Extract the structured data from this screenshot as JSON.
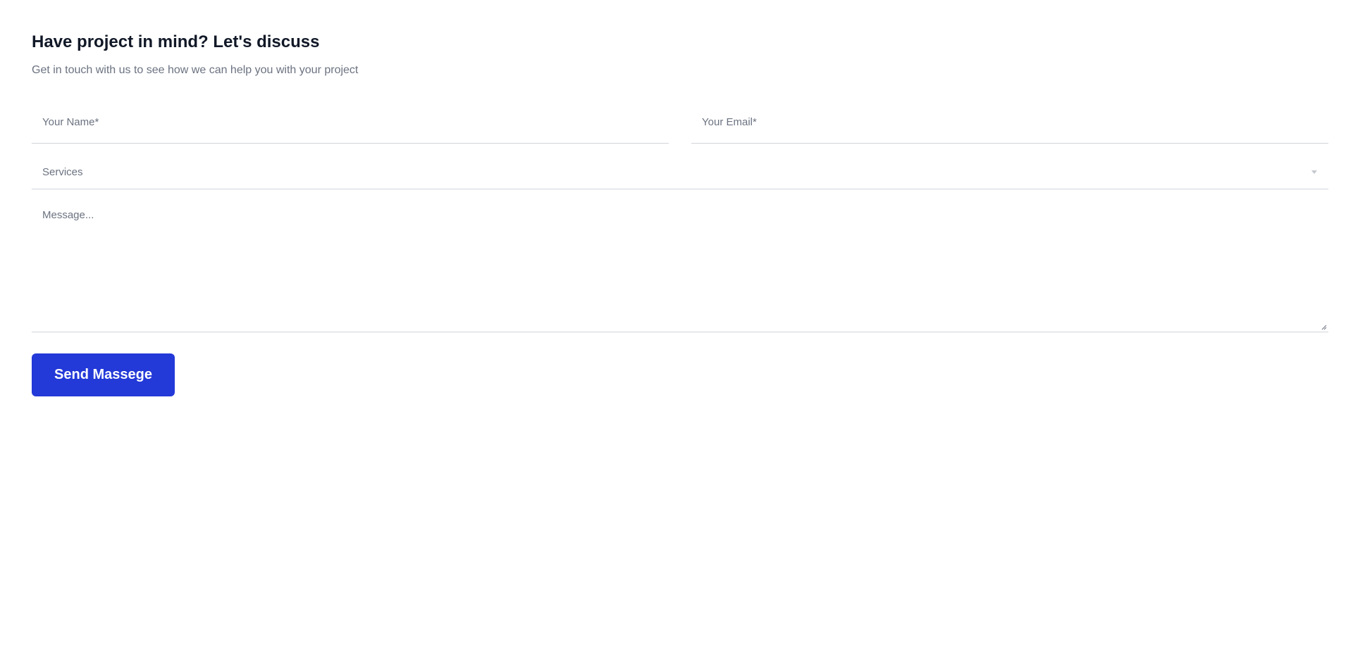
{
  "contact": {
    "title": "Have project in mind? Let's discuss",
    "subtitle": "Get in touch with us to see how we can help you with your project",
    "name_placeholder": "Your Name*",
    "email_placeholder": "Your Email*",
    "services_value": "Services",
    "services_icon": "chevron-down-icon",
    "message_placeholder": "Message...",
    "resize_icon": "resize-handle-icon",
    "send_label": "Send Massege"
  },
  "colors": {
    "accent": "#2339d8",
    "title": "#111827",
    "muted_text": "#6b7280",
    "border": "#d1d5db"
  }
}
